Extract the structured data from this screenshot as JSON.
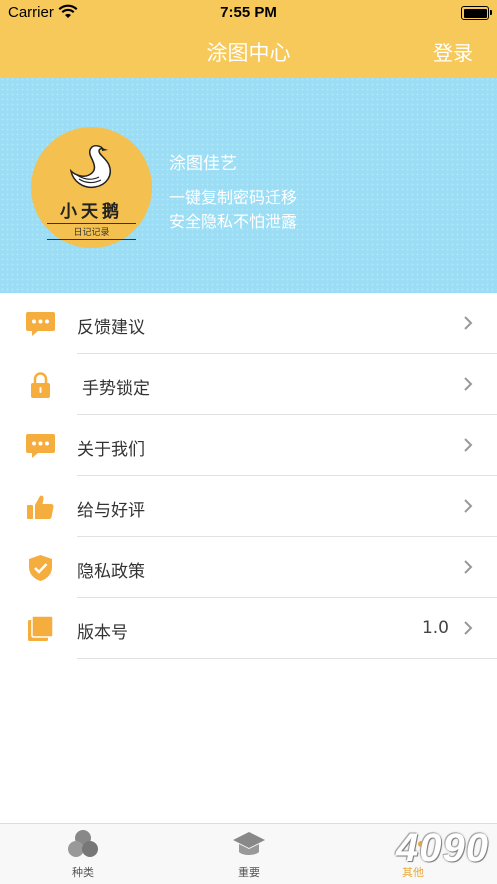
{
  "status_bar": {
    "carrier": "Carrier",
    "time": "7:55 PM"
  },
  "nav": {
    "title": "涂图中心",
    "login_label": "登录"
  },
  "banner": {
    "logo_name": "小天鹅",
    "logo_sub": "日记记录",
    "title": "涂图佳艺",
    "line1": "一键复制密码迁移",
    "line2": "安全隐私不怕泄露"
  },
  "menu": [
    {
      "label": "反馈建议",
      "icon": "chat-bubble-icon"
    },
    {
      "label": "手势锁定",
      "icon": "lock-icon"
    },
    {
      "label": "关于我们",
      "icon": "chat-bubble-icon"
    },
    {
      "label": "给与好评",
      "icon": "thumbs-up-icon"
    },
    {
      "label": "隐私政策",
      "icon": "shield-check-icon"
    },
    {
      "label": "版本号",
      "icon": "layers-icon",
      "value": "1.0"
    }
  ],
  "tabbar": [
    {
      "label": "种类",
      "icon": "circles-icon"
    },
    {
      "label": "重要",
      "icon": "graduation-cap-icon"
    },
    {
      "label": "其他",
      "icon": "more-icon",
      "active": true
    }
  ],
  "watermark": "4090",
  "colors": {
    "accent": "#F7C95A",
    "icon": "#F5AD3E",
    "banner": "#9ADDF4"
  }
}
